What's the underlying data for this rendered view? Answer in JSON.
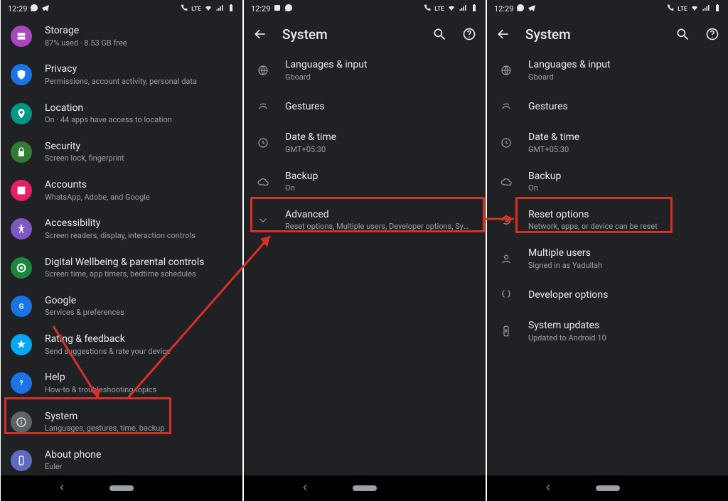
{
  "status": {
    "time": "12:29",
    "lte": "LTE"
  },
  "panel1": {
    "items": [
      {
        "id": "storage",
        "title": "Storage",
        "sub": "87% used · 8.53 GB free",
        "color": "#ab47bc"
      },
      {
        "id": "privacy",
        "title": "Privacy",
        "sub": "Permissions, account activity, personal data",
        "color": "#1a73e8"
      },
      {
        "id": "location",
        "title": "Location",
        "sub": "On · 44 apps have access to location",
        "color": "#009688"
      },
      {
        "id": "security",
        "title": "Security",
        "sub": "Screen lock, fingerprint",
        "color": "#2e7d32"
      },
      {
        "id": "accounts",
        "title": "Accounts",
        "sub": "WhatsApp, Adobe, and Google",
        "color": "#e91e63"
      },
      {
        "id": "accessibility",
        "title": "Accessibility",
        "sub": "Screen readers, display, interaction controls",
        "color": "#7e57c2"
      },
      {
        "id": "wellbeing",
        "title": "Digital Wellbeing & parental controls",
        "sub": "Screen time, app timers, bedtime schedules",
        "color": "#1b873b"
      },
      {
        "id": "google",
        "title": "Google",
        "sub": "Services & preferences",
        "color": "#1a73e8"
      },
      {
        "id": "rating",
        "title": "Rating & feedback",
        "sub": "Send suggestions & rate your device",
        "color": "#03a9f4"
      },
      {
        "id": "help",
        "title": "Help",
        "sub": "How-to & troubleshooting topics",
        "color": "#1a73e8"
      },
      {
        "id": "system",
        "title": "System",
        "sub": "Languages, gestures, time, backup",
        "color": "#757575"
      },
      {
        "id": "about",
        "title": "About phone",
        "sub": "Euler",
        "color": "#5c6bc0"
      }
    ]
  },
  "panel2": {
    "title": "System",
    "items": [
      {
        "id": "languages",
        "title": "Languages & input",
        "sub": "Gboard"
      },
      {
        "id": "gestures",
        "title": "Gestures",
        "sub": ""
      },
      {
        "id": "datetime",
        "title": "Date & time",
        "sub": "GMT+05:30"
      },
      {
        "id": "backup",
        "title": "Backup",
        "sub": "On"
      },
      {
        "id": "advanced",
        "title": "Advanced",
        "sub": "Reset options, Multiple users, Developer options, System updat.."
      }
    ]
  },
  "panel3": {
    "title": "System",
    "items": [
      {
        "id": "languages",
        "title": "Languages & input",
        "sub": "Gboard"
      },
      {
        "id": "gestures",
        "title": "Gestures",
        "sub": ""
      },
      {
        "id": "datetime",
        "title": "Date & time",
        "sub": "GMT+05:30"
      },
      {
        "id": "backup",
        "title": "Backup",
        "sub": "On"
      },
      {
        "id": "reset",
        "title": "Reset options",
        "sub": "Network, apps, or device can be reset"
      },
      {
        "id": "users",
        "title": "Multiple users",
        "sub": "Signed in as Yadullah"
      },
      {
        "id": "dev",
        "title": "Developer options",
        "sub": ""
      },
      {
        "id": "updates",
        "title": "System updates",
        "sub": "Updated to Android 10"
      }
    ]
  }
}
